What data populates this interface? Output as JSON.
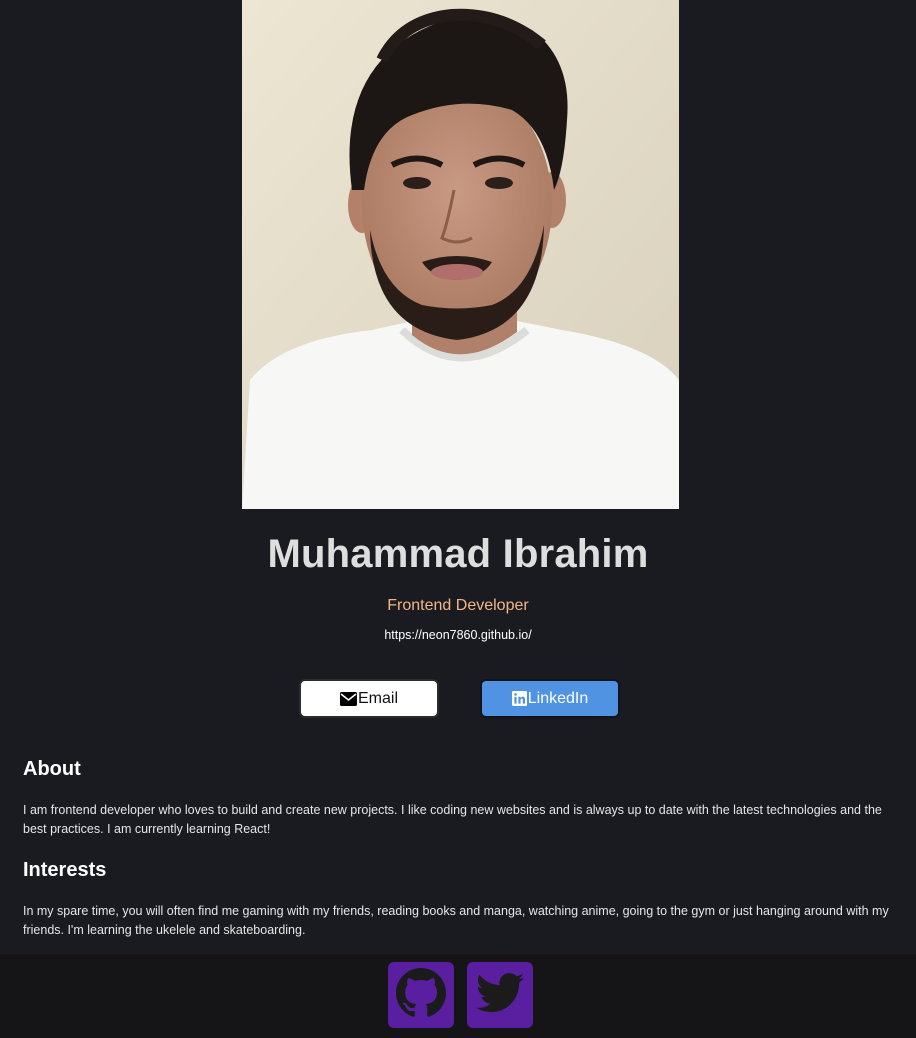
{
  "profile": {
    "name": "Muhammad Ibrahim",
    "role": "Frontend Developer",
    "website": "https://neon7860.github.io/"
  },
  "buttons": {
    "email_label": "Email",
    "email_icon": "envelope-icon",
    "linkedin_label": "LinkedIn",
    "linkedin_icon": "linkedin-icon"
  },
  "about": {
    "title": "About",
    "text": "I am frontend developer who loves to build and create new projects. I like coding new websites and is always up to date with the latest technologies and the best practices. I am currently learning React!"
  },
  "interests": {
    "title": "Interests",
    "text": "In my spare time, you will often find me gaming with my friends, reading books and manga, watching anime, going to the gym or just hanging around with my friends. I'm learning the ukelele and skateboarding."
  },
  "footer": {
    "links": [
      {
        "icon": "github-icon"
      },
      {
        "icon": "twitter-icon"
      }
    ]
  },
  "colors": {
    "background": "#1a1b21",
    "footer_background": "#151518",
    "role_text": "#f3b685",
    "linkedin_button": "#5093e2",
    "social_button": "#5a1fa0"
  }
}
